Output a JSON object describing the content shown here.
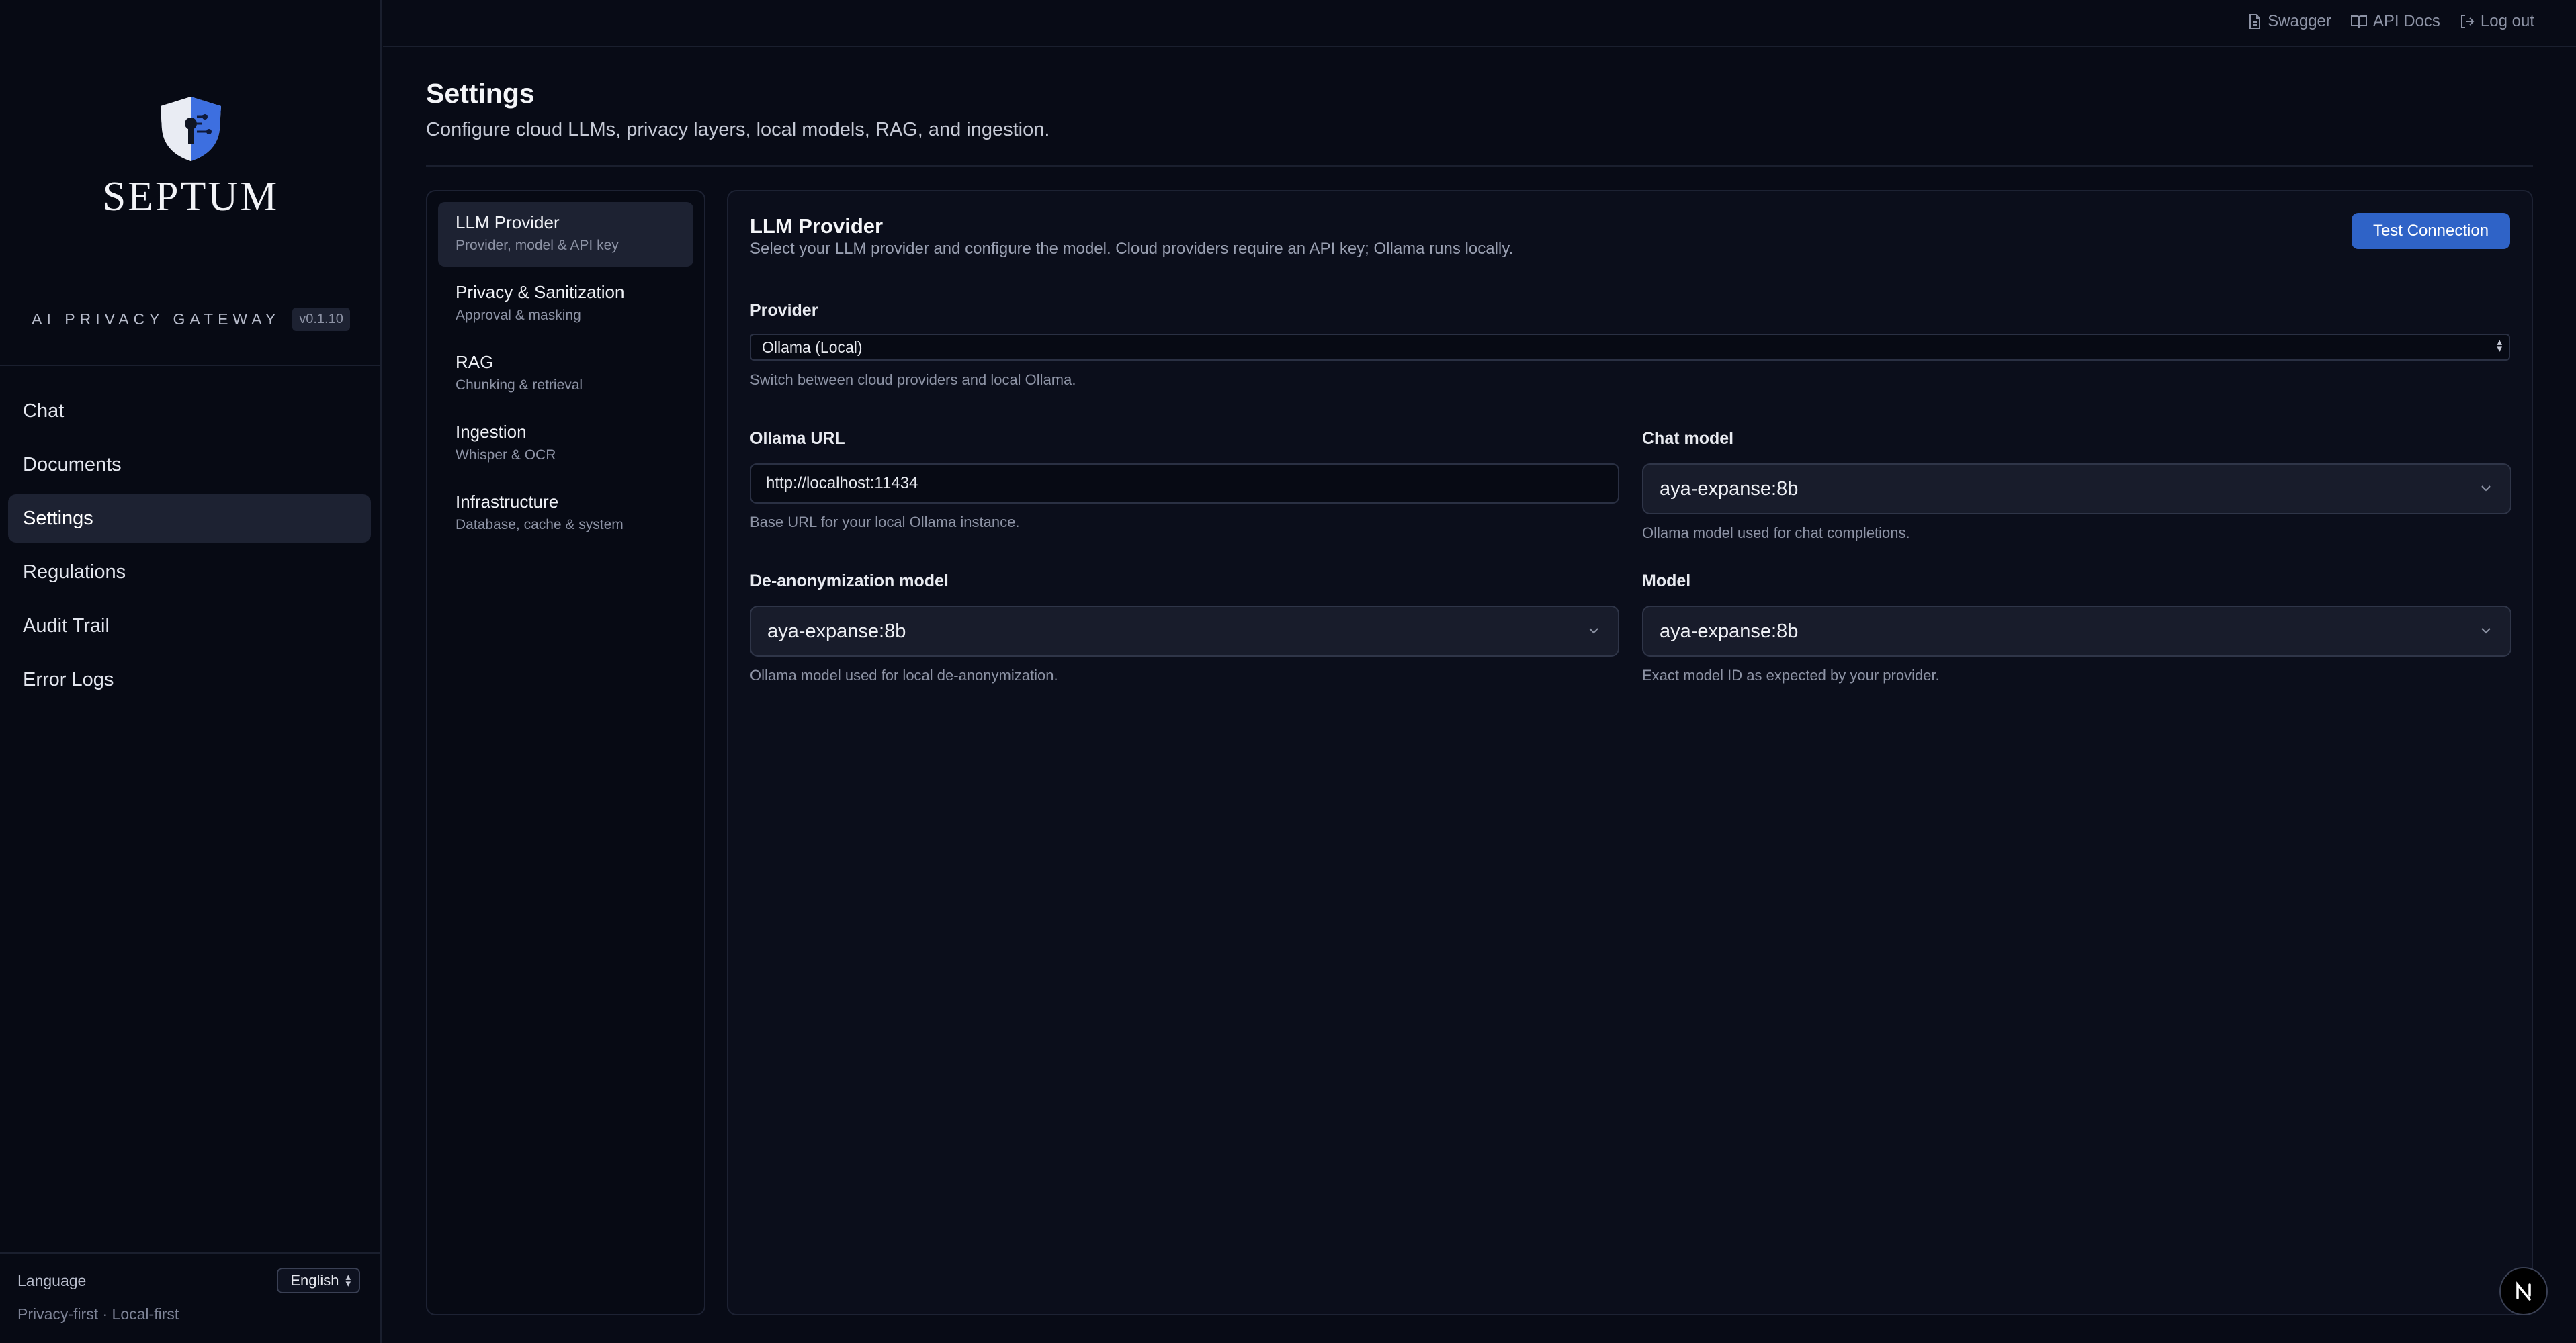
{
  "brand": {
    "name": "SEPTUM",
    "tagline": "AI PRIVACY GATEWAY",
    "version": "v0.1.10"
  },
  "nav": {
    "items": [
      {
        "label": "Chat"
      },
      {
        "label": "Documents"
      },
      {
        "label": "Settings"
      },
      {
        "label": "Regulations"
      },
      {
        "label": "Audit Trail"
      },
      {
        "label": "Error Logs"
      }
    ],
    "active": "Settings"
  },
  "sidebar_footer": {
    "language_label": "Language",
    "language_value": "English",
    "footer_text": "Privacy-first · Local-first"
  },
  "topbar": {
    "links": [
      {
        "label": "Swagger",
        "icon": "file-icon"
      },
      {
        "label": "API Docs",
        "icon": "book-icon"
      },
      {
        "label": "Log out",
        "icon": "logout-icon"
      }
    ]
  },
  "page": {
    "title": "Settings",
    "subtitle": "Configure cloud LLMs, privacy layers, local models, RAG, and ingestion."
  },
  "settings_tabs": [
    {
      "title": "LLM Provider",
      "subtitle": "Provider, model & API key"
    },
    {
      "title": "Privacy & Sanitization",
      "subtitle": "Approval & masking"
    },
    {
      "title": "RAG",
      "subtitle": "Chunking & retrieval"
    },
    {
      "title": "Ingestion",
      "subtitle": "Whisper & OCR"
    },
    {
      "title": "Infrastructure",
      "subtitle": "Database, cache & system"
    }
  ],
  "panel": {
    "title": "LLM Provider",
    "subtitle": "Select your LLM provider and configure the model. Cloud providers require an API key; Ollama runs locally.",
    "test_button": "Test Connection",
    "provider": {
      "label": "Provider",
      "value": "Ollama (Local)",
      "hint": "Switch between cloud providers and local Ollama."
    },
    "ollama_url": {
      "label": "Ollama URL",
      "value": "http://localhost:11434",
      "hint": "Base URL for your local Ollama instance."
    },
    "chat_model": {
      "label": "Chat model",
      "value": "aya-expanse:8b",
      "hint": "Ollama model used for chat completions."
    },
    "deanon_model": {
      "label": "De-anonymization model",
      "value": "aya-expanse:8b",
      "hint": "Ollama model used for local de-anonymization."
    },
    "model": {
      "label": "Model",
      "value": "aya-expanse:8b",
      "hint": "Exact model ID as expected by your provider."
    }
  },
  "badge": {
    "letter": "N"
  },
  "colors": {
    "background": "#080b16",
    "accent": "#2f63c7",
    "active_item": "#1d2232"
  }
}
